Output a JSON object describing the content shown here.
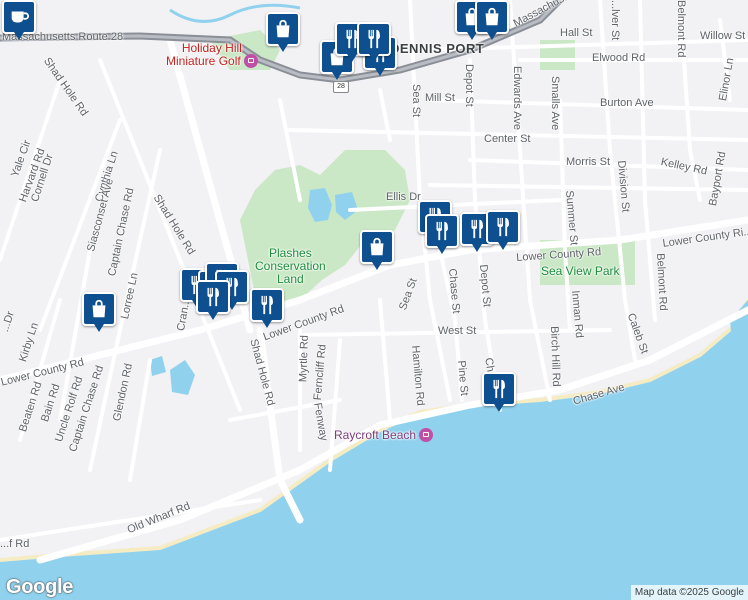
{
  "map": {
    "attribution": "Map data ©2025 Google",
    "logo": "Google",
    "route_shield": "28",
    "colors": {
      "land": "#f2f1f4",
      "water": "#90d2ee",
      "park": "#cbe8c6",
      "road": "#ffffff",
      "highway": "#8a8f98",
      "pin": "#0d4f8f"
    },
    "places": {
      "town": "DENNIS PORT",
      "golf": "Holiday Hill\nMiniature Golf",
      "golf_line1": "Holiday Hill",
      "golf_line2": "Miniature Golf",
      "conservation_line1": "Plashes",
      "conservation_line2": "Conservation",
      "conservation_line3": "Land",
      "park": "Sea View Park",
      "beach": "Raycroft Beach"
    },
    "streets": {
      "route28": "Massachusetts Route 28",
      "massachusetts": "Massachus...",
      "hall": "Hall St",
      "willow": "Willow St",
      "elwood": "Elwood Rd",
      "oliver": "...lver St",
      "belmont_top": "Belmont Rd",
      "elinor": "Elinor Ln",
      "mill": "Mill St",
      "burton": "Burton Ave",
      "edwards": "Edwards Ave",
      "smalls": "Smalls Ave",
      "depot_top": "Depot St",
      "sea_top": "Sea St",
      "center": "Center St",
      "morris": "Morris St",
      "kelley": "Kelley Rd",
      "bayport": "Bayport Rd",
      "division": "Division St",
      "summer": "Summer St",
      "ellis": "Ellis Dr",
      "lower_county_e": "Lower County Rd",
      "lower_county_far": "Lower County Ri...",
      "lower_county_c": "Lower County Rd",
      "lower_county_w": "Lower County Rd",
      "depot_mid": "Depot St",
      "chase_st": "Chase St",
      "sea_mid": "Sea St",
      "inman": "Inman Rd",
      "belmont": "Belmont Rd",
      "caleb": "Caleb St",
      "birch": "Birch Hill Rd",
      "west": "West St",
      "hamilton": "Hamilton Rd",
      "pine": "Pine St",
      "chase_rd": "Chase Rd",
      "chase_ave": "Chase Ave",
      "shad_hole_n": "Shad Hole Rd",
      "shad_hole_m": "Shad Hole Rd",
      "shad_hole_s": "Shad Hole Rd",
      "myrtle": "Myrtle Rd",
      "ferncliff": "Ferncliff Rd",
      "fenway": "Fenway",
      "old_wharf": "Old Wharf Rd",
      "old_wharf_w": "...f Rd",
      "yale": "Yale Cir",
      "harvard": "Harvard Rd",
      "cornell": "Cornell Dr",
      "cynthia": "Cynthia Ln",
      "siasconset": "Siasconset Ave",
      "captain_chase": "Captain Chase Rd",
      "captain_chase_s": "Captain Chase Rd",
      "lorree": "Lorree Ln",
      "kirby": "Kirby Ln",
      "beaten": "Beaten Rd",
      "bain": "Bain Rd",
      "uncle_rolf": "Uncle Rolf Rd",
      "glendon": "Glendon Rd",
      "cran": "Cran...",
      "dr_w": "...Dr"
    },
    "pins": [
      {
        "id": "pin-coffee-1",
        "icon": "coffee-icon"
      },
      {
        "id": "pin-shop-1",
        "icon": "shopping-bag-icon"
      },
      {
        "id": "pin-shop-2",
        "icon": "shopping-bag-icon"
      },
      {
        "id": "pin-shop-3",
        "icon": "shopping-bag-icon"
      },
      {
        "id": "pin-shop-4",
        "icon": "shopping-bag-icon"
      },
      {
        "id": "pin-restaurant-1",
        "icon": "restaurant-icon"
      },
      {
        "id": "pin-restaurant-2",
        "icon": "restaurant-icon"
      },
      {
        "id": "pin-restaurant-3",
        "icon": "restaurant-icon"
      },
      {
        "id": "pin-shop-5",
        "icon": "shopping-bag-icon"
      },
      {
        "id": "pin-restaurant-4",
        "icon": "restaurant-icon"
      },
      {
        "id": "pin-restaurant-5",
        "icon": "restaurant-icon"
      },
      {
        "id": "pin-restaurant-6",
        "icon": "restaurant-icon"
      },
      {
        "id": "pin-restaurant-7",
        "icon": "restaurant-icon"
      },
      {
        "id": "pin-restaurant-8",
        "icon": "restaurant-icon"
      },
      {
        "id": "pin-restaurant-9",
        "icon": "restaurant-icon"
      },
      {
        "id": "pin-restaurant-10",
        "icon": "restaurant-icon"
      },
      {
        "id": "pin-restaurant-11",
        "icon": "restaurant-icon"
      },
      {
        "id": "pin-restaurant-12",
        "icon": "restaurant-icon"
      },
      {
        "id": "pin-shop-6",
        "icon": "shopping-bag-icon"
      },
      {
        "id": "pin-restaurant-13",
        "icon": "restaurant-icon"
      },
      {
        "id": "pin-restaurant-14",
        "icon": "restaurant-icon"
      }
    ]
  }
}
